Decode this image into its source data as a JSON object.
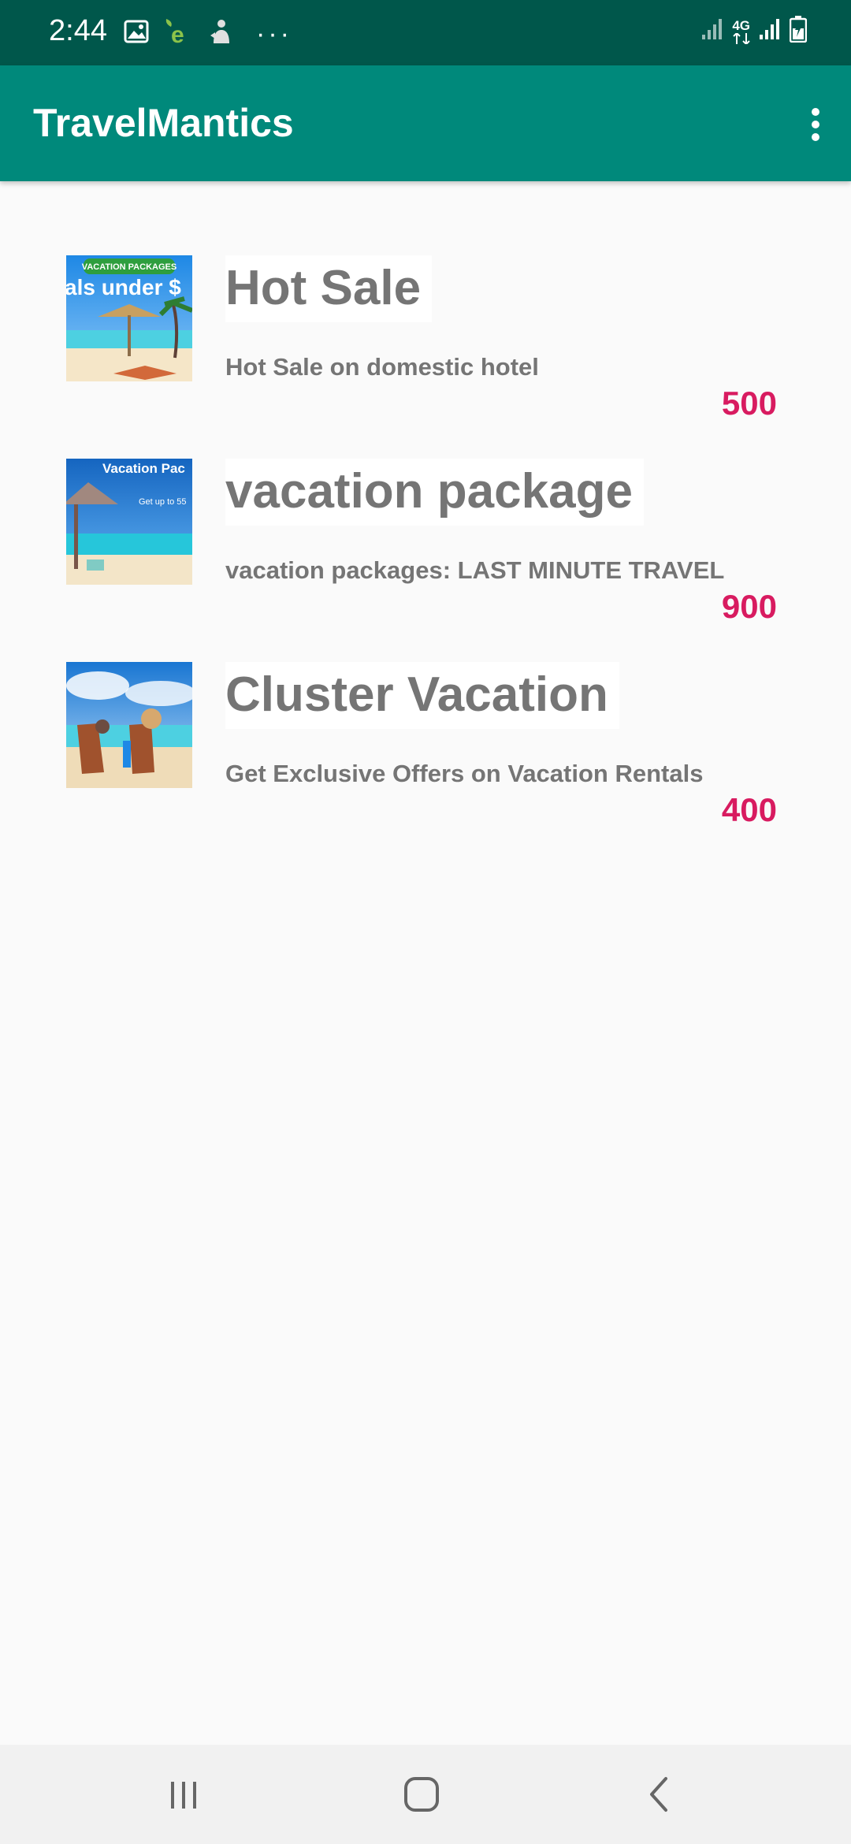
{
  "status_bar": {
    "time": "2:44",
    "network": "4G",
    "icons_left": [
      "image-icon",
      "e-app-icon",
      "sync-person-icon",
      "more-dots-icon"
    ],
    "icons_right": [
      "signal-icon",
      "4g-icon",
      "signal-icon",
      "battery-charging-icon"
    ],
    "dots": "···"
  },
  "app_bar": {
    "title": "TravelMantics",
    "menu_icon": "overflow-menu-icon",
    "color": "#00897b"
  },
  "deals": [
    {
      "title": "Hot Sale",
      "description": "Hot Sale on domestic hotel",
      "price": "500",
      "thumb_banner": "VACATION PACKAGES",
      "thumb_text": "als under $"
    },
    {
      "title": "vacation package",
      "description": "vacation packages: LAST MINUTE TRAVEL",
      "price": "900",
      "thumb_banner": "Vacation Pac",
      "thumb_text": "Get up to 55"
    },
    {
      "title": "Cluster Vacation",
      "description": "Get Exclusive Offers on Vacation Rentals",
      "price": "400"
    }
  ],
  "colors": {
    "status_bar": "#00574b",
    "price": "#d81b60",
    "text": "#757575"
  },
  "nav_bar": {
    "icons": [
      "recent-apps-icon",
      "home-icon",
      "back-icon"
    ]
  }
}
